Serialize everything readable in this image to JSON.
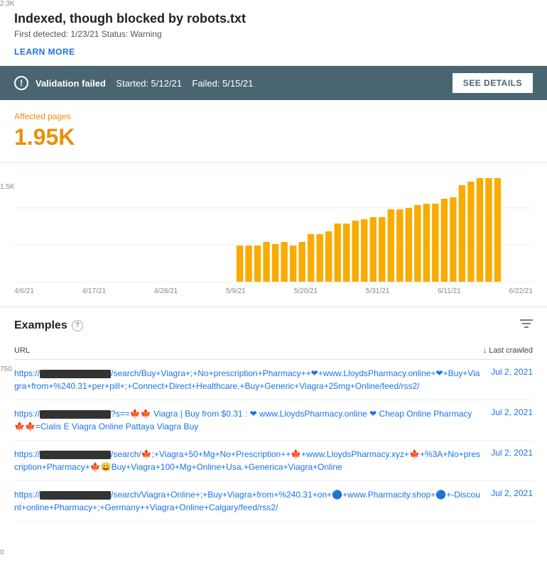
{
  "header": {
    "title": "Indexed, though blocked by robots.txt",
    "meta": "First detected: 1/23/21   Status: Warning",
    "learn_more": "LEARN MORE"
  },
  "validation_banner": {
    "icon_label": "!",
    "status_label": "Validation failed",
    "started_label": "Started: 5/12/21",
    "failed_label": "Failed: 5/15/21",
    "see_details_label": "SEE DETAILS"
  },
  "affected_pages": {
    "label": "Affected pages",
    "count": "1.95K"
  },
  "chart": {
    "y_labels": [
      "2.3K",
      "1.5K",
      "750",
      "0"
    ],
    "x_labels": [
      "4/6/21",
      "4/17/21",
      "4/28/21",
      "5/9/21",
      "5/20/21",
      "5/31/21",
      "6/11/21",
      "6/22/21"
    ]
  },
  "examples": {
    "title": "Examples",
    "help_icon": "?",
    "filter_icon": "≡",
    "table": {
      "col_url": "URL",
      "col_last_crawled": "↓ Last crawled",
      "rows": [
        {
          "url_prefix": "https://",
          "url_text": "/search/Buy+Viagra+;+No+prescription+Pharmacy++❤+www.LloydsPharmacy.online+❤+Buy+Viagra+from+%240.31+per+pill+;+Connect+Direct+Healthcare.+Buy+Generic+Viagra+25mg+Online/feed/rss2/",
          "date": "Jul 2, 2021"
        },
        {
          "url_prefix": "https://",
          "url_text": "?s==🍁🍁 Viagra | Buy from $0.31 : ❤ www.LloydsPharmacy.online ❤ Cheap Online Pharmacy 🍁🍁=Cialis E Viagra Online Pattaya Viagra Buy",
          "date": "Jul 2, 2021"
        },
        {
          "url_prefix": "https://",
          "url_text": "/search/🍁;+Viagra+50+Mg+No+Prescription++🍁+www.LloydsPharmacy.xyz+🍁+%3A+No+prescription+Pharmacy+🍁😀Buy+Viagra+100+Mg+Online+Usa.+Generica+Viagra+Online",
          "date": "Jul 2, 2021"
        },
        {
          "url_prefix": "https://",
          "url_text": "/search/Viagra+Online+;+Buy+Viagra+from+%240.31+on+🔵+www.Pharmacity.shop+🔵+-Discount+online+Pharmacy+;+Germany++Viagra+Online+Calgary/feed/rss2/",
          "date": "Jul 2, 2021"
        }
      ]
    }
  }
}
